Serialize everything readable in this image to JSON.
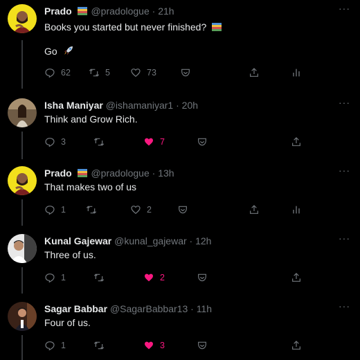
{
  "tweets": [
    {
      "name": "Prado",
      "handle": "@pradologue",
      "time": "21h",
      "lines": [
        "Books you started but never finished?",
        "Go"
      ],
      "replies": "62",
      "retweets": "5",
      "likes": "73",
      "liked": false,
      "show_stats": true
    },
    {
      "name": "Isha Maniyar",
      "handle": "@ishamaniyar1",
      "time": "20h",
      "lines": [
        "Think and Grow Rich."
      ],
      "replies": "3",
      "retweets": "",
      "likes": "7",
      "liked": true,
      "show_stats": false
    },
    {
      "name": "Prado",
      "handle": "@pradologue",
      "time": "13h",
      "lines": [
        "That makes two of us"
      ],
      "replies": "1",
      "retweets": "",
      "likes": "2",
      "liked": false,
      "show_stats": true
    },
    {
      "name": "Kunal Gajewar",
      "handle": "@kunal_gajewar",
      "time": "12h",
      "lines": [
        "Three of us."
      ],
      "replies": "1",
      "retweets": "",
      "likes": "2",
      "liked": true,
      "show_stats": false
    },
    {
      "name": "Sagar Babbar",
      "handle": "@SagarBabbar13",
      "time": "11h",
      "lines": [
        "Four of us."
      ],
      "replies": "1",
      "retweets": "",
      "likes": "3",
      "liked": true,
      "show_stats": false
    }
  ],
  "separator": "·",
  "more_glyph": "···",
  "colors": {
    "like": "#f91880",
    "muted": "#71767b",
    "avatar_prado": "#f2e01c"
  }
}
